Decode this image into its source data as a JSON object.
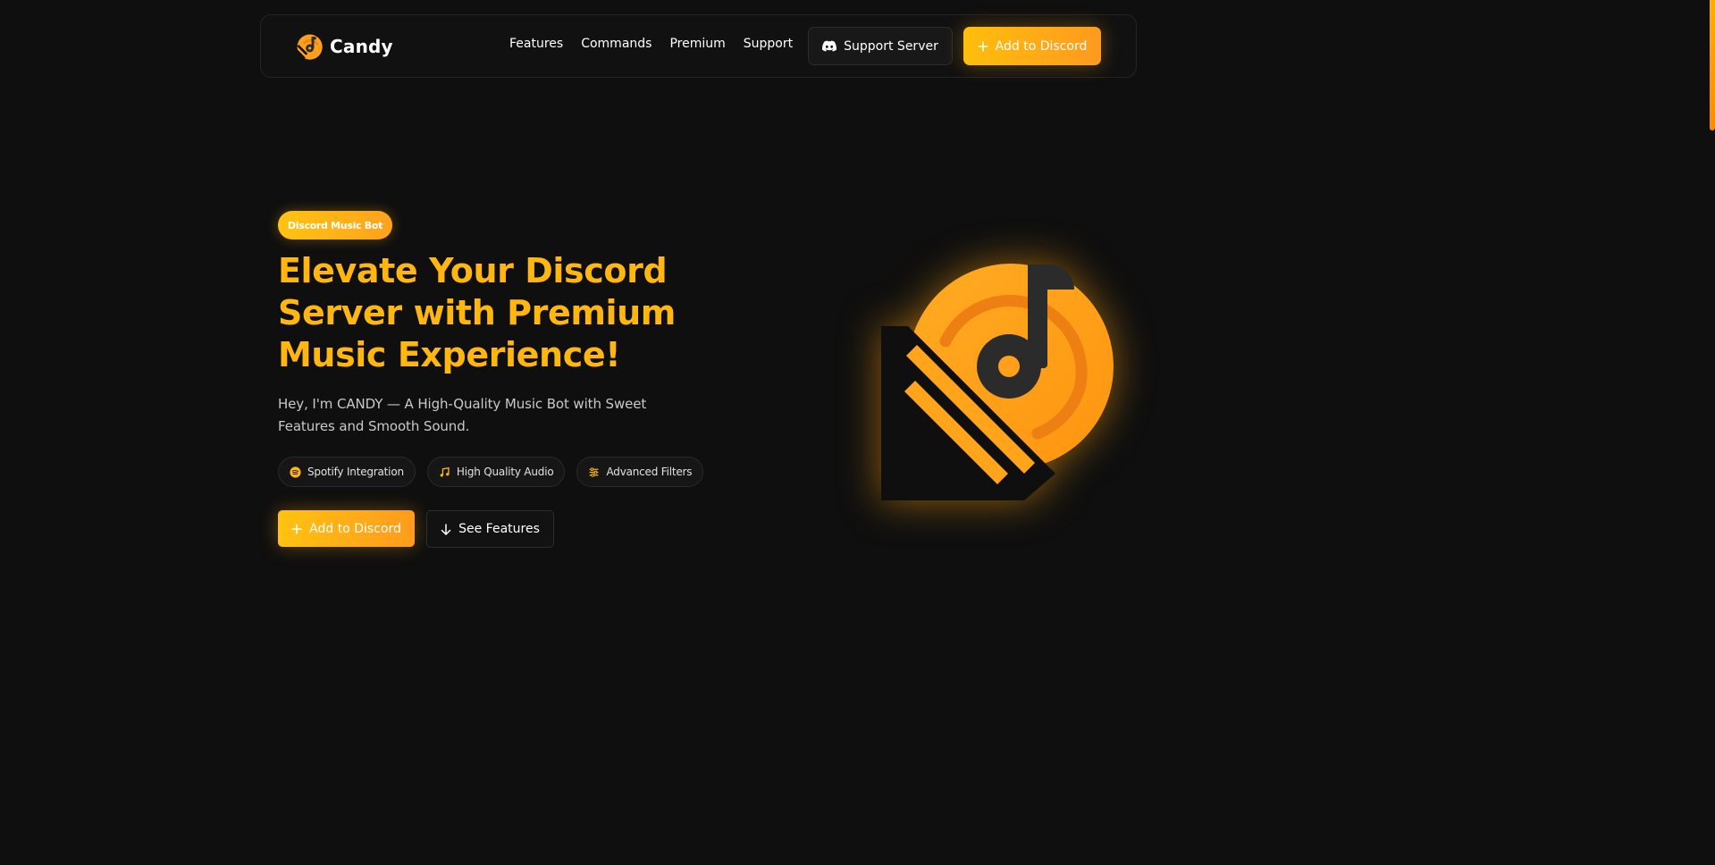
{
  "brand": {
    "name": "Candy",
    "accent": "#ffb70f",
    "logo_icon": "candy-music-disc-icon"
  },
  "nav": {
    "links": [
      "Features",
      "Commands",
      "Premium",
      "Support"
    ],
    "support_button": "Support Server",
    "support_icon": "discord-icon",
    "add_button": "Add to Discord",
    "add_icon": "plus-icon"
  },
  "hero": {
    "badge": "Discord Music Bot",
    "title": "Elevate Your Discord Server with Premium Music Experience!",
    "subtitle": "Hey, I'm CANDY — A High-Quality Music Bot with Sweet Features and Smooth Sound.",
    "chips": [
      {
        "label": "Spotify Integration",
        "icon": "spotify-icon"
      },
      {
        "label": "High Quality Audio",
        "icon": "music-note-icon"
      },
      {
        "label": "Advanced Filters",
        "icon": "sliders-icon"
      }
    ],
    "primary_button": "Add to Discord",
    "secondary_button": "See Features",
    "secondary_icon": "arrow-down-icon"
  },
  "colors": {
    "background": "#0f0f0f",
    "gradient_start": "#ffc211",
    "gradient_end": "#ff9b1d",
    "logo_dark": "#2b2b2b"
  }
}
